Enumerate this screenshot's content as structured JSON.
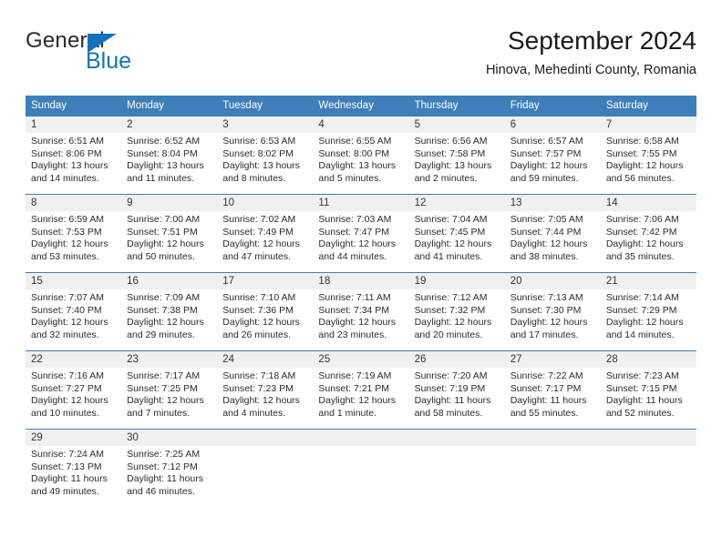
{
  "brand": {
    "name_top": "General",
    "name_bottom": "Blue",
    "flag_color": "#1273ba",
    "text_color": "#2b2b2b"
  },
  "header": {
    "title": "September 2024",
    "subtitle": "Hinova, Mehedinti County, Romania"
  },
  "theme": {
    "header_blue": "#3d7ebb",
    "date_band_gray": "#f0f0f0",
    "cell_white": "#ffffff"
  },
  "weekdays": [
    "Sunday",
    "Monday",
    "Tuesday",
    "Wednesday",
    "Thursday",
    "Friday",
    "Saturday"
  ],
  "weeks": [
    [
      {
        "day": "1",
        "sunrise": "Sunrise: 6:51 AM",
        "sunset": "Sunset: 8:06 PM",
        "daylight_1": "Daylight: 13 hours",
        "daylight_2": "and 14 minutes."
      },
      {
        "day": "2",
        "sunrise": "Sunrise: 6:52 AM",
        "sunset": "Sunset: 8:04 PM",
        "daylight_1": "Daylight: 13 hours",
        "daylight_2": "and 11 minutes."
      },
      {
        "day": "3",
        "sunrise": "Sunrise: 6:53 AM",
        "sunset": "Sunset: 8:02 PM",
        "daylight_1": "Daylight: 13 hours",
        "daylight_2": "and 8 minutes."
      },
      {
        "day": "4",
        "sunrise": "Sunrise: 6:55 AM",
        "sunset": "Sunset: 8:00 PM",
        "daylight_1": "Daylight: 13 hours",
        "daylight_2": "and 5 minutes."
      },
      {
        "day": "5",
        "sunrise": "Sunrise: 6:56 AM",
        "sunset": "Sunset: 7:58 PM",
        "daylight_1": "Daylight: 13 hours",
        "daylight_2": "and 2 minutes."
      },
      {
        "day": "6",
        "sunrise": "Sunrise: 6:57 AM",
        "sunset": "Sunset: 7:57 PM",
        "daylight_1": "Daylight: 12 hours",
        "daylight_2": "and 59 minutes."
      },
      {
        "day": "7",
        "sunrise": "Sunrise: 6:58 AM",
        "sunset": "Sunset: 7:55 PM",
        "daylight_1": "Daylight: 12 hours",
        "daylight_2": "and 56 minutes."
      }
    ],
    [
      {
        "day": "8",
        "sunrise": "Sunrise: 6:59 AM",
        "sunset": "Sunset: 7:53 PM",
        "daylight_1": "Daylight: 12 hours",
        "daylight_2": "and 53 minutes."
      },
      {
        "day": "9",
        "sunrise": "Sunrise: 7:00 AM",
        "sunset": "Sunset: 7:51 PM",
        "daylight_1": "Daylight: 12 hours",
        "daylight_2": "and 50 minutes."
      },
      {
        "day": "10",
        "sunrise": "Sunrise: 7:02 AM",
        "sunset": "Sunset: 7:49 PM",
        "daylight_1": "Daylight: 12 hours",
        "daylight_2": "and 47 minutes."
      },
      {
        "day": "11",
        "sunrise": "Sunrise: 7:03 AM",
        "sunset": "Sunset: 7:47 PM",
        "daylight_1": "Daylight: 12 hours",
        "daylight_2": "and 44 minutes."
      },
      {
        "day": "12",
        "sunrise": "Sunrise: 7:04 AM",
        "sunset": "Sunset: 7:45 PM",
        "daylight_1": "Daylight: 12 hours",
        "daylight_2": "and 41 minutes."
      },
      {
        "day": "13",
        "sunrise": "Sunrise: 7:05 AM",
        "sunset": "Sunset: 7:44 PM",
        "daylight_1": "Daylight: 12 hours",
        "daylight_2": "and 38 minutes."
      },
      {
        "day": "14",
        "sunrise": "Sunrise: 7:06 AM",
        "sunset": "Sunset: 7:42 PM",
        "daylight_1": "Daylight: 12 hours",
        "daylight_2": "and 35 minutes."
      }
    ],
    [
      {
        "day": "15",
        "sunrise": "Sunrise: 7:07 AM",
        "sunset": "Sunset: 7:40 PM",
        "daylight_1": "Daylight: 12 hours",
        "daylight_2": "and 32 minutes."
      },
      {
        "day": "16",
        "sunrise": "Sunrise: 7:09 AM",
        "sunset": "Sunset: 7:38 PM",
        "daylight_1": "Daylight: 12 hours",
        "daylight_2": "and 29 minutes."
      },
      {
        "day": "17",
        "sunrise": "Sunrise: 7:10 AM",
        "sunset": "Sunset: 7:36 PM",
        "daylight_1": "Daylight: 12 hours",
        "daylight_2": "and 26 minutes."
      },
      {
        "day": "18",
        "sunrise": "Sunrise: 7:11 AM",
        "sunset": "Sunset: 7:34 PM",
        "daylight_1": "Daylight: 12 hours",
        "daylight_2": "and 23 minutes."
      },
      {
        "day": "19",
        "sunrise": "Sunrise: 7:12 AM",
        "sunset": "Sunset: 7:32 PM",
        "daylight_1": "Daylight: 12 hours",
        "daylight_2": "and 20 minutes."
      },
      {
        "day": "20",
        "sunrise": "Sunrise: 7:13 AM",
        "sunset": "Sunset: 7:30 PM",
        "daylight_1": "Daylight: 12 hours",
        "daylight_2": "and 17 minutes."
      },
      {
        "day": "21",
        "sunrise": "Sunrise: 7:14 AM",
        "sunset": "Sunset: 7:29 PM",
        "daylight_1": "Daylight: 12 hours",
        "daylight_2": "and 14 minutes."
      }
    ],
    [
      {
        "day": "22",
        "sunrise": "Sunrise: 7:16 AM",
        "sunset": "Sunset: 7:27 PM",
        "daylight_1": "Daylight: 12 hours",
        "daylight_2": "and 10 minutes."
      },
      {
        "day": "23",
        "sunrise": "Sunrise: 7:17 AM",
        "sunset": "Sunset: 7:25 PM",
        "daylight_1": "Daylight: 12 hours",
        "daylight_2": "and 7 minutes."
      },
      {
        "day": "24",
        "sunrise": "Sunrise: 7:18 AM",
        "sunset": "Sunset: 7:23 PM",
        "daylight_1": "Daylight: 12 hours",
        "daylight_2": "and 4 minutes."
      },
      {
        "day": "25",
        "sunrise": "Sunrise: 7:19 AM",
        "sunset": "Sunset: 7:21 PM",
        "daylight_1": "Daylight: 12 hours",
        "daylight_2": "and 1 minute."
      },
      {
        "day": "26",
        "sunrise": "Sunrise: 7:20 AM",
        "sunset": "Sunset: 7:19 PM",
        "daylight_1": "Daylight: 11 hours",
        "daylight_2": "and 58 minutes."
      },
      {
        "day": "27",
        "sunrise": "Sunrise: 7:22 AM",
        "sunset": "Sunset: 7:17 PM",
        "daylight_1": "Daylight: 11 hours",
        "daylight_2": "and 55 minutes."
      },
      {
        "day": "28",
        "sunrise": "Sunrise: 7:23 AM",
        "sunset": "Sunset: 7:15 PM",
        "daylight_1": "Daylight: 11 hours",
        "daylight_2": "and 52 minutes."
      }
    ],
    [
      {
        "day": "29",
        "sunrise": "Sunrise: 7:24 AM",
        "sunset": "Sunset: 7:13 PM",
        "daylight_1": "Daylight: 11 hours",
        "daylight_2": "and 49 minutes."
      },
      {
        "day": "30",
        "sunrise": "Sunrise: 7:25 AM",
        "sunset": "Sunset: 7:12 PM",
        "daylight_1": "Daylight: 11 hours",
        "daylight_2": "and 46 minutes."
      },
      {
        "day": "",
        "sunrise": "",
        "sunset": "",
        "daylight_1": "",
        "daylight_2": ""
      },
      {
        "day": "",
        "sunrise": "",
        "sunset": "",
        "daylight_1": "",
        "daylight_2": ""
      },
      {
        "day": "",
        "sunrise": "",
        "sunset": "",
        "daylight_1": "",
        "daylight_2": ""
      },
      {
        "day": "",
        "sunrise": "",
        "sunset": "",
        "daylight_1": "",
        "daylight_2": ""
      },
      {
        "day": "",
        "sunrise": "",
        "sunset": "",
        "daylight_1": "",
        "daylight_2": ""
      }
    ]
  ]
}
